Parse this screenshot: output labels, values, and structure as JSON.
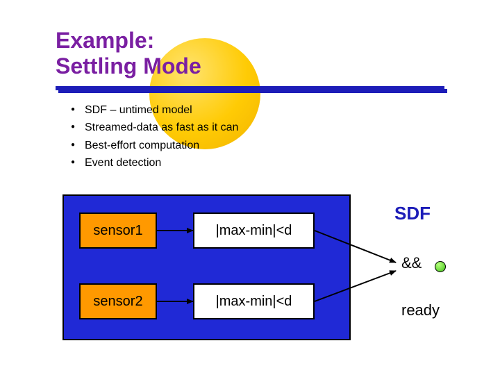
{
  "title": {
    "line1": "Example:",
    "line2": "Settling Mode"
  },
  "bullets": [
    "SDF – untimed model",
    "Streamed-data as fast as it can",
    "Best-effort computation",
    "Event detection"
  ],
  "diagram": {
    "sensor1": "sensor1",
    "sensor2": "sensor2",
    "cond1": "|max-min|<d",
    "cond2": "|max-min|<d",
    "sdf_label": "SDF",
    "and_label": "&&",
    "ready_label": "ready"
  },
  "colors": {
    "title": "#7a1fa2",
    "underline": "#1d1db8",
    "accent": "#ffcb05",
    "panel": "#2029d6",
    "sensor_box": "#ff9900"
  }
}
